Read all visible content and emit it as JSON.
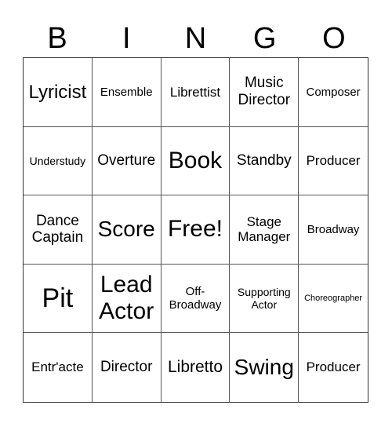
{
  "header": [
    "B",
    "I",
    "N",
    "G",
    "O"
  ],
  "cells": [
    {
      "text": "Lyricist",
      "size": "s23"
    },
    {
      "text": "Ensemble",
      "size": "s15"
    },
    {
      "text": "Librettist",
      "size": "s17"
    },
    {
      "text": "Music Director",
      "size": "s19"
    },
    {
      "text": "Composer",
      "size": "s15"
    },
    {
      "text": "Understudy",
      "size": "s13"
    },
    {
      "text": "Overture",
      "size": "s19"
    },
    {
      "text": "Book",
      "size": "s29"
    },
    {
      "text": "Standby",
      "size": "s19"
    },
    {
      "text": "Producer",
      "size": "s17"
    },
    {
      "text": "Dance Captain",
      "size": "s19"
    },
    {
      "text": "Score",
      "size": "s27"
    },
    {
      "text": "Free!",
      "size": "s29"
    },
    {
      "text": "Stage Manager",
      "size": "s17"
    },
    {
      "text": "Broadway",
      "size": "s15"
    },
    {
      "text": "Pit",
      "size": "s33"
    },
    {
      "text": "Lead Actor",
      "size": "s29"
    },
    {
      "text": "Off-Broadway",
      "size": "s15"
    },
    {
      "text": "Supporting Actor",
      "size": "s13"
    },
    {
      "text": "Choreographer",
      "size": "s11"
    },
    {
      "text": "Entr'acte",
      "size": "s17"
    },
    {
      "text": "Director",
      "size": "s19"
    },
    {
      "text": "Libretto",
      "size": "s21"
    },
    {
      "text": "Swing",
      "size": "s27"
    },
    {
      "text": "Producer",
      "size": "s17"
    }
  ]
}
